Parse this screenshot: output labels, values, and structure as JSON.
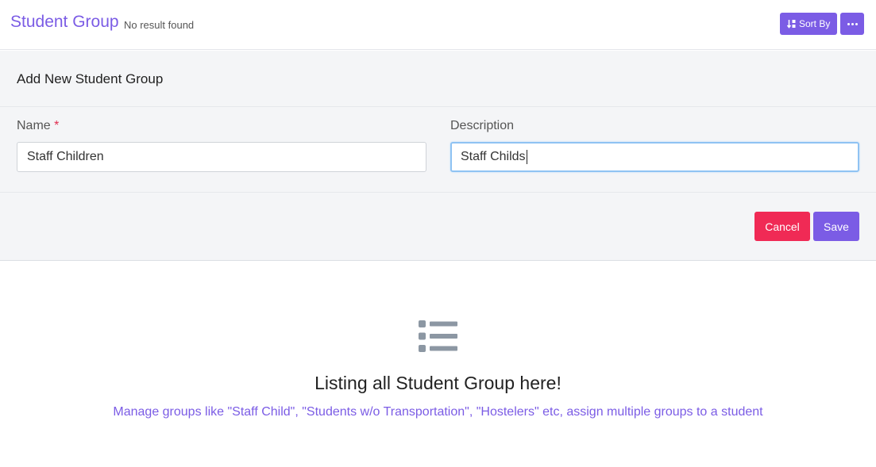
{
  "header": {
    "title": "Student Group",
    "result_text": "No result found",
    "sort_label": "Sort By",
    "sort_icon": "sort-alpha-icon",
    "more_icon": "ellipsis-icon"
  },
  "form": {
    "heading": "Add New Student Group",
    "name_label": "Name",
    "required_mark": "*",
    "name_value": "Staff Children",
    "description_label": "Description",
    "description_value": "Staff Childs",
    "cancel_label": "Cancel",
    "save_label": "Save"
  },
  "empty_state": {
    "icon": "list-icon",
    "title": "Listing all Student Group here!",
    "subtitle": "Manage groups like \"Staff Child\", \"Students w/o Transportation\", \"Hostelers\" etc, assign multiple groups to a student"
  },
  "colors": {
    "accent": "#7b5ce5",
    "danger": "#f02a55",
    "panel_bg": "#f4f5f7",
    "focus_border": "#8fc3f3"
  }
}
